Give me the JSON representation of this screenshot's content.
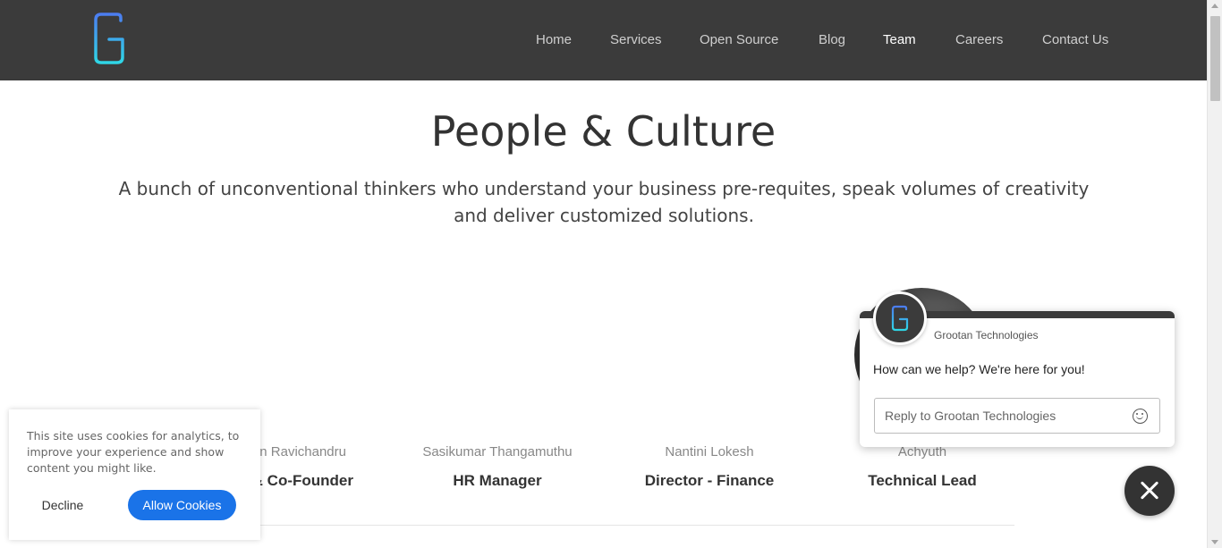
{
  "header": {
    "logo_alt": "Grootan G logo",
    "nav": [
      {
        "label": "Home"
      },
      {
        "label": "Services"
      },
      {
        "label": "Open Source"
      },
      {
        "label": "Blog"
      },
      {
        "label": "Team",
        "active": true
      },
      {
        "label": "Careers"
      },
      {
        "label": "Contact Us"
      }
    ]
  },
  "hero": {
    "title": "People & Culture",
    "subtitle": "A bunch of unconventional thinkers who understand your business pre-requites, speak volumes of creativity and deliver customized solutions."
  },
  "team": [
    {
      "name": "n Ravichandru",
      "role": "& Co-Founder"
    },
    {
      "name": "Sasikumar Thangamuthu",
      "role": "HR Manager"
    },
    {
      "name": "Nantini Lokesh",
      "role": "Director - Finance"
    },
    {
      "name": "Achyuth",
      "role": "Technical Lead"
    }
  ],
  "chat": {
    "company": "Grootan Technologies",
    "message": "How can we help? We're here for you!",
    "input_placeholder": "Reply to Grootan Technologies"
  },
  "cookie": {
    "text": "This site uses cookies for analytics, to improve your experience and show content you might like.",
    "decline_label": "Decline",
    "allow_label": "Allow Cookies"
  },
  "colors": {
    "header_bg": "#3b3b3b",
    "accent_blue": "#1a73e8",
    "logo_gradient_top": "#3b82f6",
    "logo_gradient_bottom": "#22d3ee"
  }
}
